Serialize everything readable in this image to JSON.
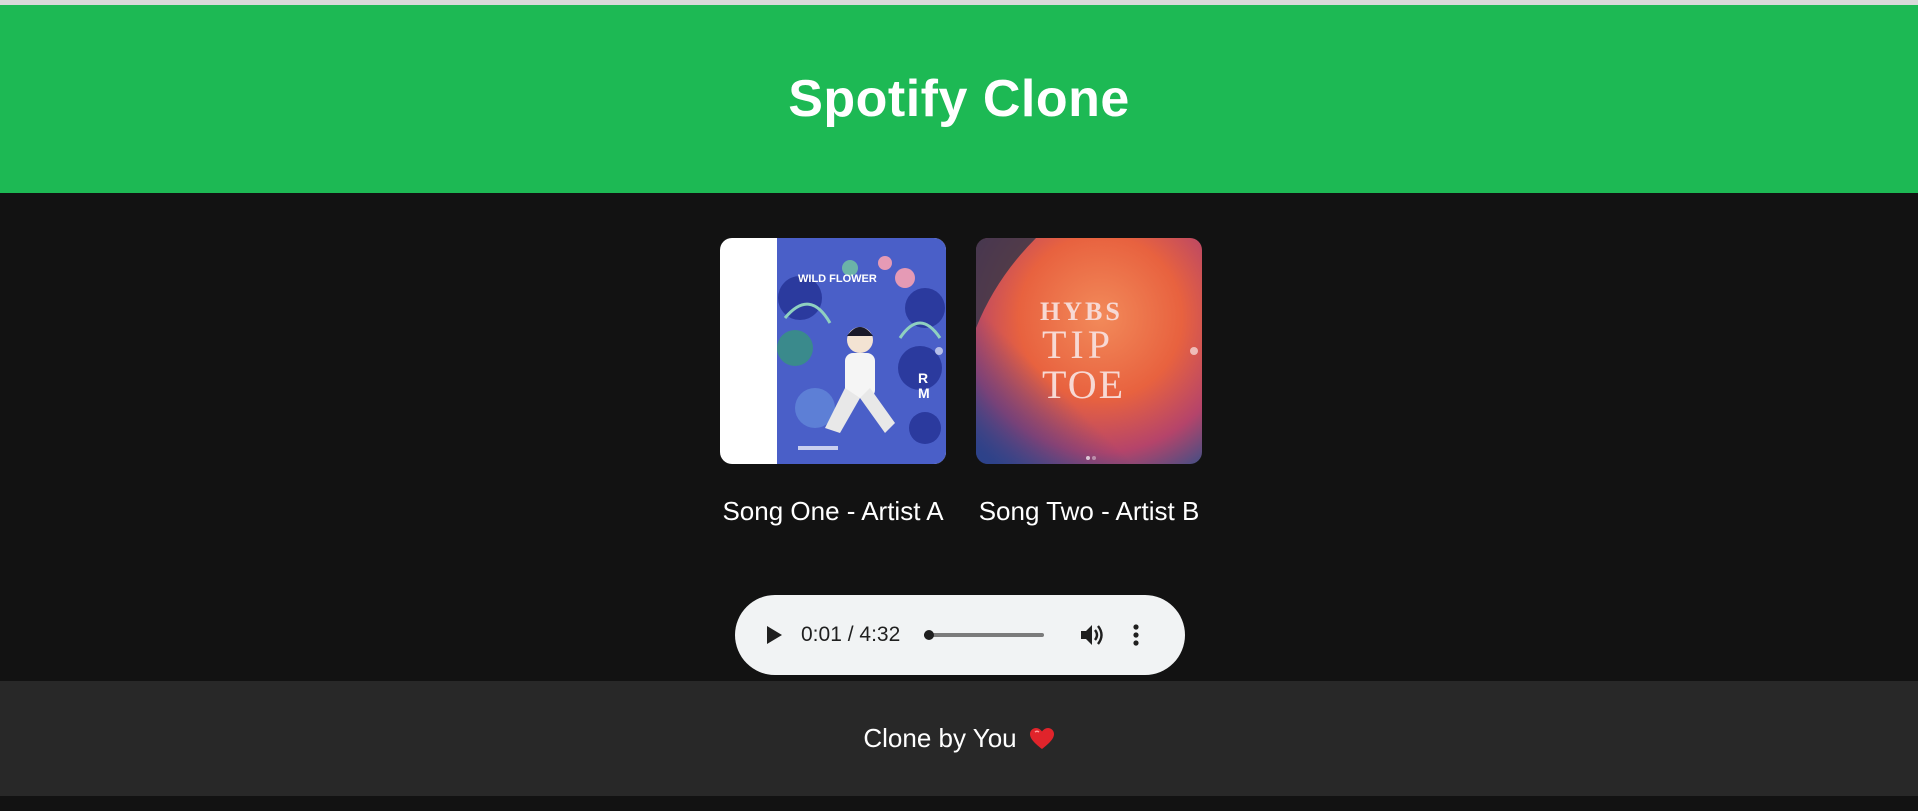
{
  "header": {
    "title": "Spotify Clone"
  },
  "songs": [
    {
      "title": "Song One - Artist A",
      "cover": {
        "text_main": "WILD FLOWER",
        "text_side": "RM"
      }
    },
    {
      "title": "Song Two - Artist B",
      "cover": {
        "text_line1": "HYBS",
        "text_line2": "TIP",
        "text_line3": "TOE"
      }
    }
  ],
  "player": {
    "current_time": "0:01",
    "duration": "4:32",
    "time_display": "0:01 / 4:32",
    "progress_fraction": 0.004
  },
  "footer": {
    "text": "Clone by You",
    "emoji_icon": "heart-icon"
  },
  "colors": {
    "brand_green": "#1db954",
    "background": "#121212",
    "footer_bg": "#282828",
    "player_bg": "#f1f3f4"
  }
}
